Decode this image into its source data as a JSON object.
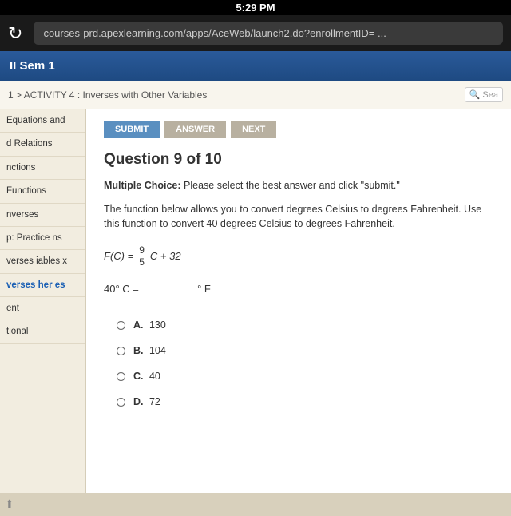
{
  "status": {
    "time": "5:29 PM"
  },
  "browser": {
    "url": "courses-prd.apexlearning.com/apps/AceWeb/launch2.do?enrollmentID= ..."
  },
  "course": {
    "title": "II Sem 1"
  },
  "breadcrumb": {
    "text": "1 > ACTIVITY 4 : Inverses with Other Variables",
    "search": "Sea"
  },
  "sidebar": {
    "items": [
      "Equations and",
      "d Relations",
      "nctions",
      "Functions",
      "nverses",
      "p: Practice ns",
      "verses iables x",
      "verses her es",
      "ent",
      "tional"
    ],
    "activeIndex": 7
  },
  "buttons": {
    "submit": "SUBMIT",
    "answer": "ANSWER",
    "next": "NEXT"
  },
  "question": {
    "title": "Question 9 of 10",
    "mc_label_bold": "Multiple Choice:",
    "mc_label_rest": " Please select the best answer and click \"submit.\"",
    "body": "The function below allows you to convert degrees Celsius to degrees Fahrenheit. Use this function to convert 40 degrees Celsius to degrees Fahrenheit.",
    "formula_lhs": "F(C) =",
    "formula_num": "9",
    "formula_den": "5",
    "formula_rhs": "C + 32",
    "conversion_lhs": "40° C =",
    "conversion_unit": "° F",
    "options": [
      {
        "letter": "A.",
        "text": "130"
      },
      {
        "letter": "B.",
        "text": "104"
      },
      {
        "letter": "C.",
        "text": "40"
      },
      {
        "letter": "D.",
        "text": "72"
      }
    ]
  }
}
